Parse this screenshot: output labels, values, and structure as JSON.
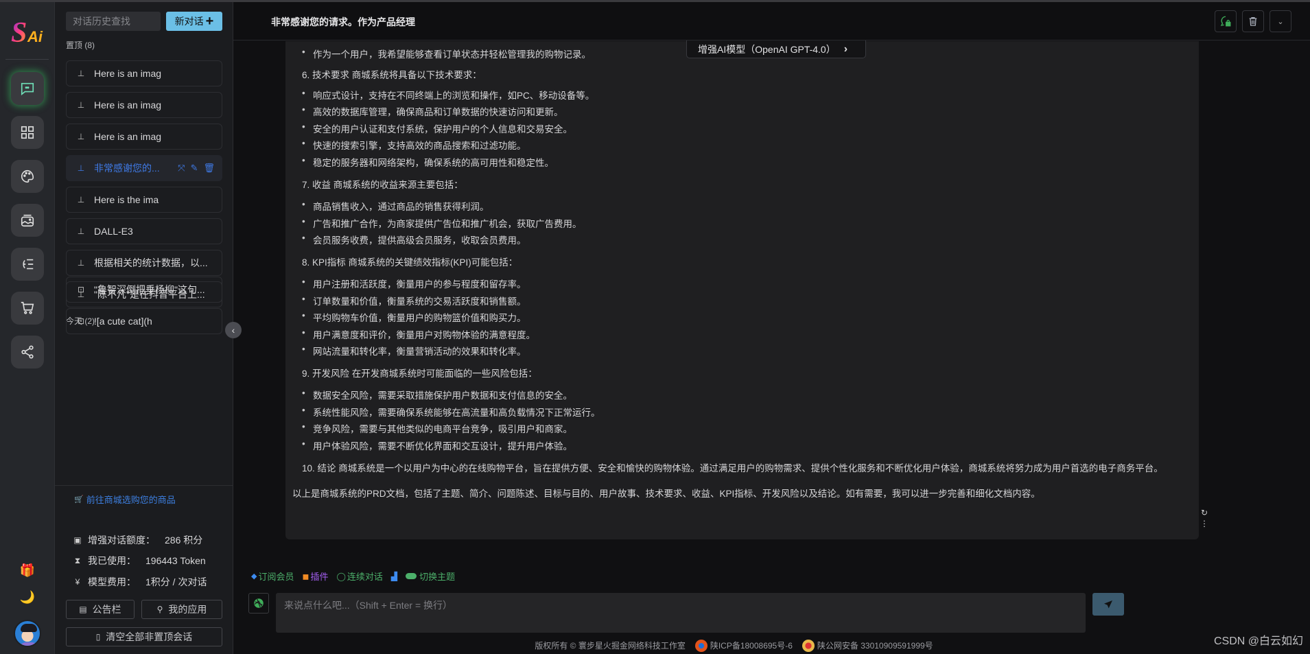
{
  "app": {
    "logo_text": "Ai",
    "logo_letter": "S"
  },
  "rail": {
    "items": [
      {
        "name": "chat",
        "icon": "chat-bubble-icon",
        "active": true
      },
      {
        "name": "apps",
        "icon": "grid-icon",
        "active": false
      },
      {
        "name": "draw",
        "icon": "palette-icon",
        "active": false
      },
      {
        "name": "gallery",
        "icon": "image-gallery-icon",
        "active": false
      },
      {
        "name": "mindmap",
        "icon": "mindmap-icon",
        "active": false
      },
      {
        "name": "shop",
        "icon": "cart-icon",
        "active": false
      },
      {
        "name": "share",
        "icon": "share-icon",
        "active": false
      }
    ],
    "gift_icon": "🎁",
    "theme_icon": "🌙"
  },
  "history": {
    "search_placeholder": "对话历史查找",
    "new_chat_label": "新对话",
    "pinned_title": "置顶",
    "pinned_count": "(8)",
    "pinned": [
      {
        "label": "Here is an imag"
      },
      {
        "label": "Here is an imag"
      },
      {
        "label": "Here is an imag"
      },
      {
        "label": "非常感谢您的...",
        "active": true
      },
      {
        "label": "Here is the ima"
      },
      {
        "label": "DALL-E3"
      },
      {
        "label": "根据相关的统计数据，以..."
      },
      {
        "label": "\"陈不凡\"是在抖音平台上..."
      }
    ],
    "today_title": "今天",
    "today_count": "(2)",
    "today": [
      {
        "label": "\"鲁智深倒把垂杨柳\"这句..."
      },
      {
        "label": "![a cute cat](h"
      }
    ],
    "shop_link": "前往商城选购您的商品",
    "stats": [
      {
        "icon": "wallet-icon",
        "label": "增强对话额度：",
        "value": "286 积分"
      },
      {
        "icon": "hourglass-icon",
        "label": "我已使用：",
        "value": "196443 Token"
      },
      {
        "icon": "coin-icon",
        "label": "模型费用：",
        "value": "1积分 / 次对话"
      }
    ],
    "notice_button": "公告栏",
    "my_apps_button": "我的应用",
    "clear_button": "清空全部非置顶会话"
  },
  "header": {
    "title": "非常感谢您的请求。作为产品经理",
    "model_tag": "增强AI模型（OpenAI GPT-4.0）"
  },
  "message": {
    "lines": [
      {
        "type": "bullet",
        "text": "作为一个用户，我希望能够查看订单状态并轻松管理我的购物记录。"
      },
      {
        "type": "heading",
        "text": "6. 技术要求 商城系统将具备以下技术要求："
      },
      {
        "type": "bullet",
        "text": "响应式设计，支持在不同终端上的浏览和操作，如PC、移动设备等。"
      },
      {
        "type": "bullet",
        "text": "高效的数据库管理，确保商品和订单数据的快速访问和更新。"
      },
      {
        "type": "bullet",
        "text": "安全的用户认证和支付系统，保护用户的个人信息和交易安全。"
      },
      {
        "type": "bullet",
        "text": "快速的搜索引擎，支持高效的商品搜索和过滤功能。"
      },
      {
        "type": "bullet",
        "text": "稳定的服务器和网络架构，确保系统的高可用性和稳定性。"
      },
      {
        "type": "heading",
        "text": "7. 收益 商城系统的收益来源主要包括："
      },
      {
        "type": "bullet",
        "text": "商品销售收入，通过商品的销售获得利润。"
      },
      {
        "type": "bullet",
        "text": "广告和推广合作，为商家提供广告位和推广机会，获取广告费用。"
      },
      {
        "type": "bullet",
        "text": "会员服务收费，提供高级会员服务，收取会员费用。"
      },
      {
        "type": "heading",
        "text": "8. KPI指标 商城系统的关键绩效指标(KPI)可能包括："
      },
      {
        "type": "bullet",
        "text": "用户注册和活跃度，衡量用户的参与程度和留存率。"
      },
      {
        "type": "bullet",
        "text": "订单数量和价值，衡量系统的交易活跃度和销售额。"
      },
      {
        "type": "bullet",
        "text": "平均购物车价值，衡量用户的购物篮价值和购买力。"
      },
      {
        "type": "bullet",
        "text": "用户满意度和评价，衡量用户对购物体验的满意程度。"
      },
      {
        "type": "bullet",
        "text": "网站流量和转化率，衡量营销活动的效果和转化率。"
      },
      {
        "type": "heading",
        "text": "9. 开发风险 在开发商城系统时可能面临的一些风险包括："
      },
      {
        "type": "bullet",
        "text": "数据安全风险，需要采取措施保护用户数据和支付信息的安全。"
      },
      {
        "type": "bullet",
        "text": "系统性能风险，需要确保系统能够在高流量和高负载情况下正常运行。"
      },
      {
        "type": "bullet",
        "text": "竞争风险，需要与其他类似的电商平台竞争，吸引用户和商家。"
      },
      {
        "type": "bullet",
        "text": "用户体验风险，需要不断优化界面和交互设计，提升用户体验。"
      },
      {
        "type": "heading",
        "text": "10. 结论 商城系统是一个以用户为中心的在线购物平台，旨在提供方便、安全和愉快的购物体验。通过满足用户的购物需求、提供个性化服务和不断优化用户体验，商城系统将努力成为用户首选的电子商务平台。"
      },
      {
        "type": "para",
        "text": "以上是商城系统的PRD文档，包括了主题、简介、问题陈述、目标与目的、用户故事、技术要求、收益、KPI指标、开发风险以及结论。如有需要，我可以进一步完善和细化文档内容。"
      }
    ]
  },
  "toolbar": {
    "subscribe": "订阅会员",
    "plugins": "插件",
    "continuous": "连续对话",
    "theme": "切换主题"
  },
  "input": {
    "placeholder": "来说点什么吧...（Shift + Enter = 换行）"
  },
  "footer": {
    "copyright": "版权所有 © 寰步星火掘金网络科技工作室",
    "icp": "陕ICP备18008695号-6",
    "police": "陕公网安备 33010909591999号"
  },
  "watermark": "CSDN @白云如幻",
  "colors": {
    "accent_blue": "#3f7ae6",
    "new_chat_bg": "#6bbfe6",
    "active_glow": "#38c864",
    "send_bg": "#3b5a6e",
    "plugin_purple": "#a35ef0",
    "green": "#4caf6a"
  }
}
